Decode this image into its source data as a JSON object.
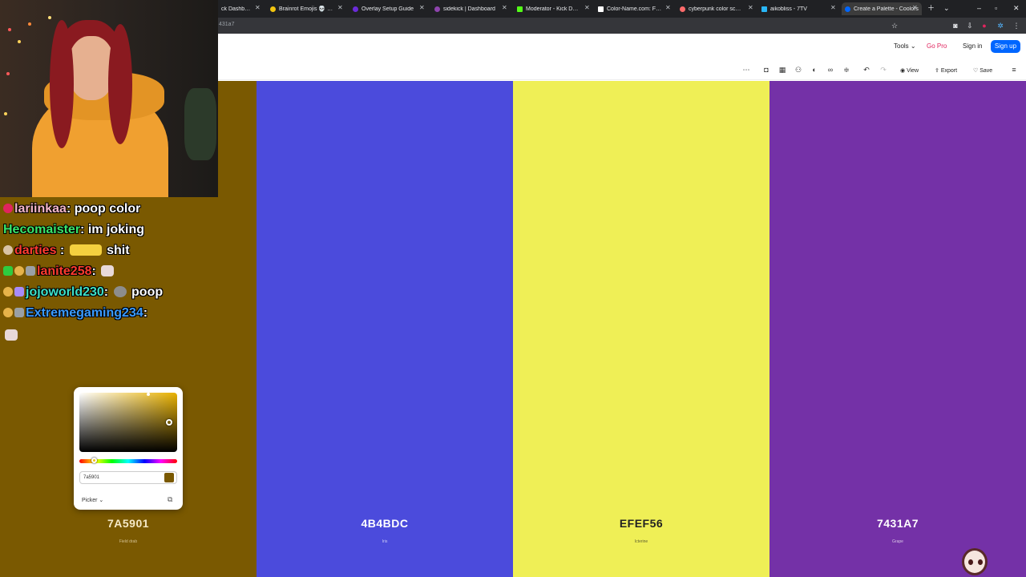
{
  "browser": {
    "tabs": [
      {
        "label": "ck Dashboard",
        "active": false,
        "favicon_color": "#53fc18"
      },
      {
        "label": "Brainrot Emojis 💀 😭 👌 |",
        "active": false,
        "favicon_color": "#f1c40f"
      },
      {
        "label": "Overlay Setup Guide",
        "active": false,
        "favicon_color": "#6b2bd9"
      },
      {
        "label": "sidekick | Dashboard",
        "active": false,
        "favicon_color": "#8e44ad"
      },
      {
        "label": "Moderator - Kick Dashboard",
        "active": false,
        "favicon_color": "#53fc18"
      },
      {
        "label": "Color-Name.com: Find nam",
        "active": false,
        "favicon_color": "#ffffff"
      },
      {
        "label": "cyberpunk color scheme at",
        "active": false,
        "favicon_color": "#ff6b6b"
      },
      {
        "label": "aikobliss - 7TV",
        "active": false,
        "favicon_color": "#29b6f6"
      },
      {
        "label": "Create a Palette - Coolors",
        "active": true,
        "favicon_color": "#0066ff"
      }
    ],
    "new_tab_icon": "plus-icon",
    "address": "431a7"
  },
  "nav": {
    "tools": "Tools",
    "go_pro": "Go Pro",
    "sign_in": "Sign in",
    "sign_up": "Sign up"
  },
  "toolbar": {
    "view": "View",
    "export": "Export",
    "save": "Save"
  },
  "palette": [
    {
      "hex": "7A5901",
      "name": "Field drab",
      "color": "#7a5901",
      "text_color": "#f5e9c8"
    },
    {
      "hex": "4B4BDC",
      "name": "Iris",
      "color": "#4b4bdc",
      "text_color": "#ffffff"
    },
    {
      "hex": "EFEF56",
      "name": "Icterine",
      "color": "#efef56",
      "text_color": "#222222"
    },
    {
      "hex": "7431A7",
      "name": "Grape",
      "color": "#7431a7",
      "text_color": "#ffffff"
    }
  ],
  "picker": {
    "input_value": "7a5901",
    "mode": "Picker"
  },
  "chat": [
    {
      "user": "lariinkaa",
      "user_color": "#f4b6c8",
      "message": ": poop color",
      "badges": [
        "#e0245e"
      ]
    },
    {
      "user": "Hecomaister",
      "user_color": "#39e66b",
      "message": ": im joking",
      "badges": []
    },
    {
      "user": "darties",
      "user_color": "#ff3b2f",
      "message": " : ",
      "emote": true,
      "message2": " shit",
      "badges": [
        "#d9c3a5"
      ]
    },
    {
      "user": "lanite258",
      "user_color": "#ff3b2f",
      "message": ": ",
      "emote": true,
      "message2": "",
      "badges": [
        "#2ecc40",
        "#e6b34a",
        "#9aa0a6"
      ]
    },
    {
      "user": "jojoworld230",
      "user_color": "#3de0c8",
      "message": ": ",
      "emote": true,
      "message2": " poop",
      "badges": [
        "#e6b34a",
        "#a78bfa"
      ]
    },
    {
      "user": "Extremegaming234",
      "user_color": "#3b9bff",
      "message": ":",
      "badges": [
        "#e6b34a",
        "#9aa0a6"
      ]
    }
  ]
}
